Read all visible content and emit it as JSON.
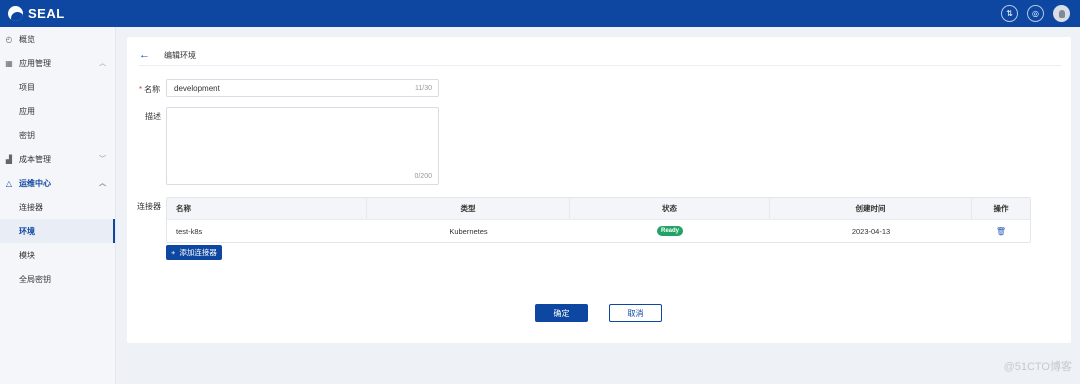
{
  "brand": {
    "name": "SEAL"
  },
  "topbar": {
    "icons": [
      "translate-icon",
      "help-icon",
      "user-avatar"
    ],
    "btn1": "⇅",
    "btn2": "◎"
  },
  "sidebar": {
    "overview": "概览",
    "app_mgmt": "应用管理",
    "projects": "项目",
    "apps": "应用",
    "secrets": "密钥",
    "cost_mgmt": "成本管理",
    "ops_center": "运维中心",
    "connectors": "连接器",
    "environments": "环境",
    "modules": "模块",
    "global_secrets": "全局密钥"
  },
  "page": {
    "back": "←",
    "title": "编辑环境",
    "name_label": "名称",
    "name_value": "development",
    "name_count": "11/30",
    "desc_label": "描述",
    "desc_value": "",
    "desc_count": "0/200",
    "connector_label": "连接器"
  },
  "table": {
    "headers": [
      "名称",
      "类型",
      "状态",
      "创建时间",
      "操作"
    ],
    "rows": [
      {
        "name": "test-k8s",
        "type": "Kubernetes",
        "status": "Ready",
        "created": "2023-04-13"
      }
    ]
  },
  "actions": {
    "add_connector": "添加连接器",
    "add_icon": "+",
    "confirm": "确定",
    "cancel": "取消"
  },
  "watermark": "@51CTO博客",
  "colors": {
    "primary": "#0d47a1",
    "status_ready": "#21a366",
    "required": "#e53935"
  }
}
